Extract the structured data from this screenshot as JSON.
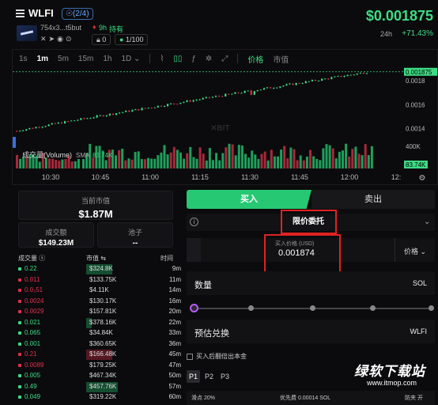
{
  "header": {
    "token": "WLFI",
    "verify_badge": "☉(2/4)",
    "address": "754x3...t5but",
    "age": "9h",
    "holding_label": "持有",
    "icon_names": [
      "x-icon",
      "telegram-icon",
      "globe-icon",
      "search-icon"
    ],
    "lock_count": "0",
    "holders_ratio": "1/100",
    "price": "$0.001875",
    "change_label": "24h",
    "change_value": "+71.43%"
  },
  "chart_toolbar": {
    "intervals": [
      "1s",
      "1m",
      "5m",
      "15m",
      "1h",
      "1D ⌄"
    ],
    "active_interval": "1m",
    "price_label": "价格",
    "mcap_label": "市值"
  },
  "chart_data": {
    "type": "candlestick",
    "y_ticks": [
      "0.001875",
      "0.0018",
      "0.0016",
      "0.0014"
    ],
    "current_price": "0.001875",
    "ylim": [
      0.00137,
      0.00188
    ],
    "volume_label": "成交量(Volume)",
    "volume_sma_label": "SMA",
    "volume_sma_value": "83.74K",
    "volume_tick": "400K",
    "volume_marker": "83.74K",
    "x_ticks": [
      "10:30",
      "10:45",
      "11:00",
      "11:15",
      "11:30",
      "11:45",
      "12:00",
      "12:"
    ],
    "watermark": "✕BIT"
  },
  "stats": {
    "mcap_label": "当前市值",
    "mcap_value": "$1.87M",
    "volume_label": "成交额",
    "volume_value": "$149.23M",
    "pool_label": "池子",
    "pool_value": "--"
  },
  "trades": {
    "col_amount": "成交量 ⓢ",
    "col_mcap": "市值 ⇆",
    "col_time": "时间",
    "rows": [
      {
        "amount": "0.22",
        "mcap": "$324.8K",
        "time": "9m",
        "side": "buy",
        "bar": 0.82
      },
      {
        "amount": "0.011",
        "mcap": "$133.75K",
        "time": "11m",
        "side": "sell",
        "bar": 0
      },
      {
        "amount": "0.0₂51",
        "mcap": "$4.11K",
        "time": "14m",
        "side": "sell",
        "bar": 0
      },
      {
        "amount": "0.0024",
        "mcap": "$130.17K",
        "time": "16m",
        "side": "sell",
        "bar": 0
      },
      {
        "amount": "0.0029",
        "mcap": "$157.81K",
        "time": "20m",
        "side": "sell",
        "bar": 0
      },
      {
        "amount": "0.021",
        "mcap": "$378.16K",
        "time": "22m",
        "side": "buy",
        "bar": 0.18
      },
      {
        "amount": "0.065",
        "mcap": "$34.84K",
        "time": "33m",
        "side": "buy",
        "bar": 0
      },
      {
        "amount": "0.001",
        "mcap": "$360.65K",
        "time": "36m",
        "side": "buy",
        "bar": 0
      },
      {
        "amount": "0.21",
        "mcap": "$166.48K",
        "time": "45m",
        "side": "sell",
        "bar": 0.82
      },
      {
        "amount": "0.0089",
        "mcap": "$179.25K",
        "time": "47m",
        "side": "sell",
        "bar": 0
      },
      {
        "amount": "0.005",
        "mcap": "$467.34K",
        "time": "50m",
        "side": "buy",
        "bar": 0
      },
      {
        "amount": "0.49",
        "mcap": "$457.76K",
        "time": "57m",
        "side": "buy",
        "bar": 1.0
      },
      {
        "amount": "0.049",
        "mcap": "$319.22K",
        "time": "60m",
        "side": "buy",
        "bar": 0
      }
    ]
  },
  "trade_panel": {
    "buy_tab": "买入",
    "sell_tab": "卖出",
    "order_type": "限价委托",
    "price_label": "买入价格 (USD)",
    "price_value": "0.001874",
    "price_unit": "价格 ⌄",
    "qty_label": "数量",
    "qty_unit": "SOL",
    "est_label": "预估兑换",
    "est_unit": "WLFI",
    "checkbox_label": "买入后翻倍出本金",
    "presets": [
      "P1",
      "P2",
      "P3"
    ],
    "slippage": "滑点 20%",
    "priority_fee": "优先费 0.00014 SOL",
    "anti_mev": "防夹 开"
  },
  "watermark": {
    "name": "绿软下载站",
    "url": "www.itmop.com"
  },
  "colors": {
    "up": "#3ddc84",
    "down": "#e0314b",
    "buy_tab": "#27c873",
    "highlight_box": "#e02222"
  }
}
